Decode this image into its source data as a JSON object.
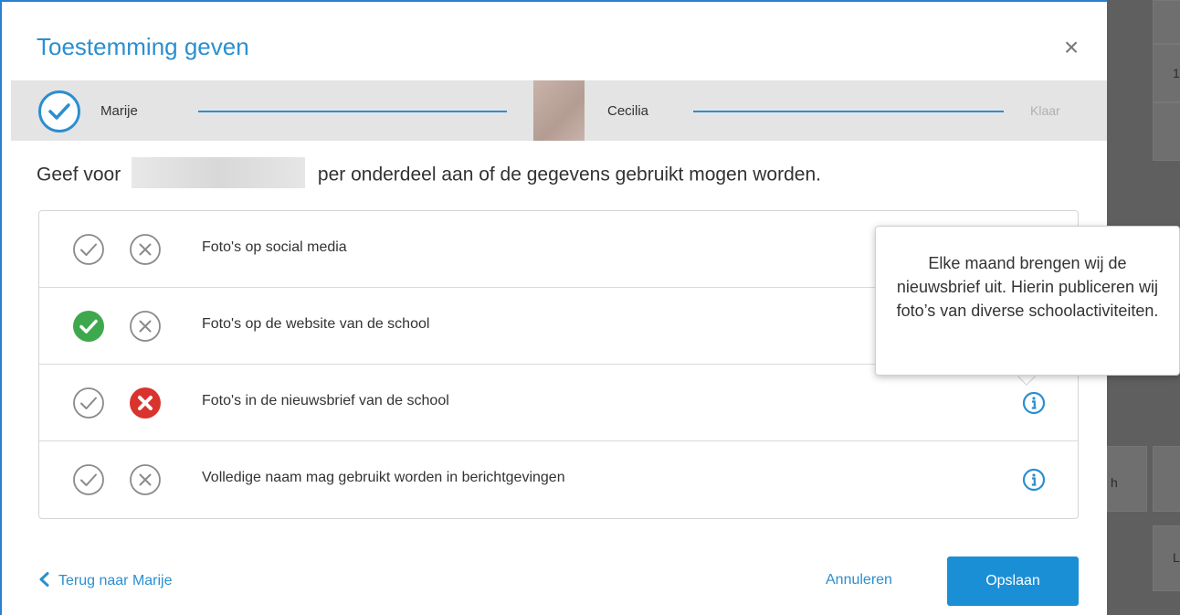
{
  "dialog": {
    "title": "Toestemming geven",
    "close_label": "×"
  },
  "stepper": {
    "step1_label": "Marije",
    "step2_label": "Cecilia",
    "step3_label": "Klaar"
  },
  "instruction": {
    "prefix": "Geef voor",
    "suffix": "per onderdeel aan of de gegevens gebruikt mogen worden."
  },
  "consent_items": [
    {
      "label": "Foto's op social media",
      "state": "none",
      "has_info": false
    },
    {
      "label": "Foto's op de website van de school",
      "state": "yes",
      "has_info": false
    },
    {
      "label": "Foto's in de nieuwsbrief van de school",
      "state": "no",
      "has_info": true
    },
    {
      "label": "Volledige naam mag gebruikt worden in berichtgevingen",
      "state": "none",
      "has_info": true
    }
  ],
  "tooltip": {
    "text": "Elke maand brengen wij de nieuwsbrief uit. Hierin publiceren wij foto’s van diverse schoolactiviteiten."
  },
  "footer": {
    "back_label": "Terug naar Marije",
    "cancel_label": "Annuleren",
    "save_label": "Opslaan"
  },
  "background_fragments": [
    "1",
    "h",
    "L"
  ],
  "colors": {
    "accent": "#2b8fd0",
    "yes_green": "#3ea84d",
    "no_red": "#d9332e",
    "neutral_icon": "#8a8a8a"
  }
}
